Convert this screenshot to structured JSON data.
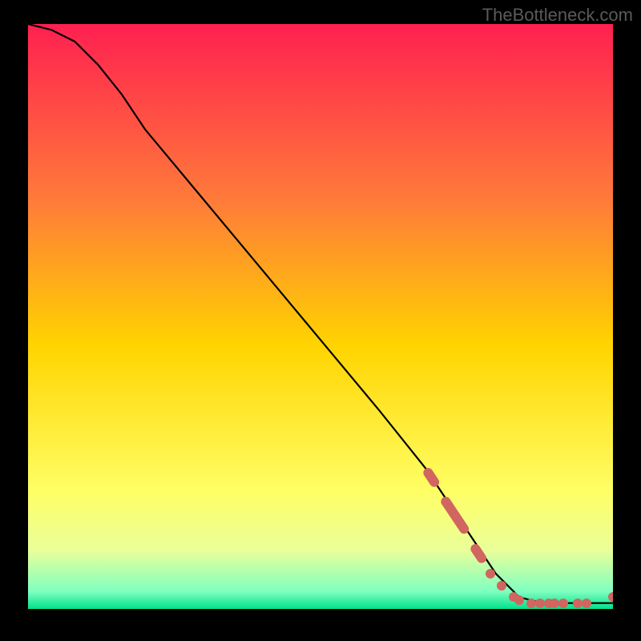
{
  "watermark": "TheBottleneck.com",
  "chart_data": {
    "type": "line",
    "title": "",
    "xlabel": "",
    "ylabel": "",
    "xlim": [
      0,
      100
    ],
    "ylim": [
      0,
      100
    ],
    "grid": false,
    "legend": false,
    "background": {
      "type": "vertical-gradient",
      "stops": [
        {
          "pos": 0.0,
          "color": "#ff2050"
        },
        {
          "pos": 0.3,
          "color": "#ff7a3a"
        },
        {
          "pos": 0.55,
          "color": "#ffd400"
        },
        {
          "pos": 0.8,
          "color": "#ffff66"
        },
        {
          "pos": 0.9,
          "color": "#eaff9a"
        },
        {
          "pos": 0.97,
          "color": "#7fffc0"
        },
        {
          "pos": 1.0,
          "color": "#00e28a"
        }
      ]
    },
    "series": [
      {
        "name": "bottleneck-curve",
        "type": "line",
        "color": "#000000",
        "x": [
          0,
          4,
          8,
          12,
          16,
          20,
          30,
          40,
          50,
          60,
          68,
          72,
          76,
          80,
          84,
          88,
          92,
          96,
          100
        ],
        "y": [
          100,
          99,
          97,
          93,
          88,
          82,
          70,
          58,
          46,
          34,
          24,
          18,
          12,
          6,
          2,
          1,
          1,
          1,
          1
        ]
      },
      {
        "name": "highlight-segments",
        "type": "scatter-segments",
        "color": "#d16560",
        "segments": [
          {
            "x1": 68,
            "y1": 24,
            "x2": 70,
            "y2": 21
          },
          {
            "x1": 71,
            "y1": 19,
            "x2": 75,
            "y2": 13
          },
          {
            "x1": 76,
            "y1": 11,
            "x2": 78,
            "y2": 8
          }
        ],
        "points": [
          {
            "x": 79,
            "y": 6
          },
          {
            "x": 81,
            "y": 4
          },
          {
            "x": 83,
            "y": 2
          },
          {
            "x": 84,
            "y": 1.5
          },
          {
            "x": 86,
            "y": 1
          },
          {
            "x": 87.5,
            "y": 1
          },
          {
            "x": 89,
            "y": 1
          },
          {
            "x": 90,
            "y": 1
          },
          {
            "x": 91.5,
            "y": 1
          },
          {
            "x": 94,
            "y": 1
          },
          {
            "x": 95.5,
            "y": 1
          },
          {
            "x": 100,
            "y": 2
          }
        ]
      }
    ]
  }
}
